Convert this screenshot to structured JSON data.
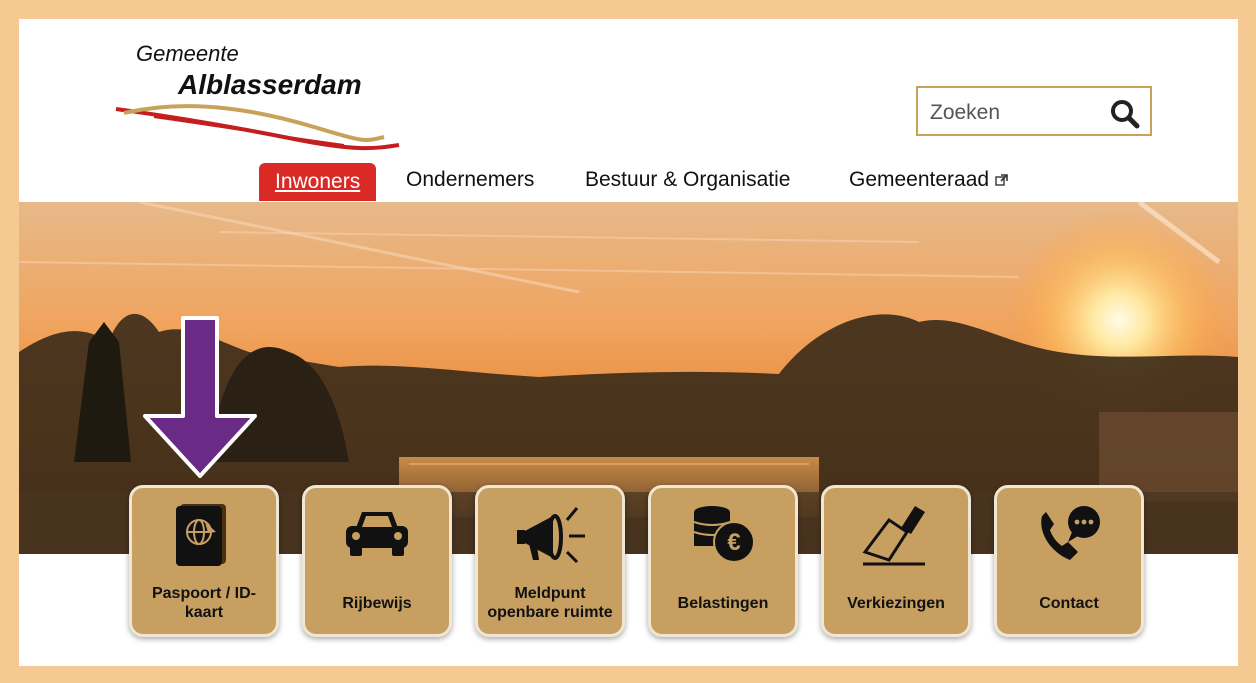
{
  "logo": {
    "line1": "Gemeente",
    "line2": "Alblasserdam"
  },
  "search": {
    "placeholder": "Zoeken",
    "icon": "search-icon"
  },
  "nav": {
    "items": [
      {
        "label": "Inwoners",
        "active": true
      },
      {
        "label": "Ondernemers",
        "active": false
      },
      {
        "label": "Bestuur & Organisatie",
        "active": false
      },
      {
        "label": "Gemeenteraad",
        "active": false,
        "icon": "external-link-icon"
      }
    ]
  },
  "tiles": [
    {
      "label": "Paspoort / ID-kaart",
      "icon": "passport-icon"
    },
    {
      "label": "Rijbewijs",
      "icon": "car-icon"
    },
    {
      "label": "Meldpunt openbare ruimte",
      "icon": "megaphone-icon"
    },
    {
      "label": "Belastingen",
      "icon": "euro-coins-icon"
    },
    {
      "label": "Verkiezingen",
      "icon": "ballot-icon"
    },
    {
      "label": "Contact",
      "icon": "phone-chat-icon"
    }
  ],
  "colors": {
    "frame": "#f5c992",
    "accent_red": "#d92a25",
    "tile_bg": "#c7a061",
    "arrow": "#6b2a86"
  }
}
